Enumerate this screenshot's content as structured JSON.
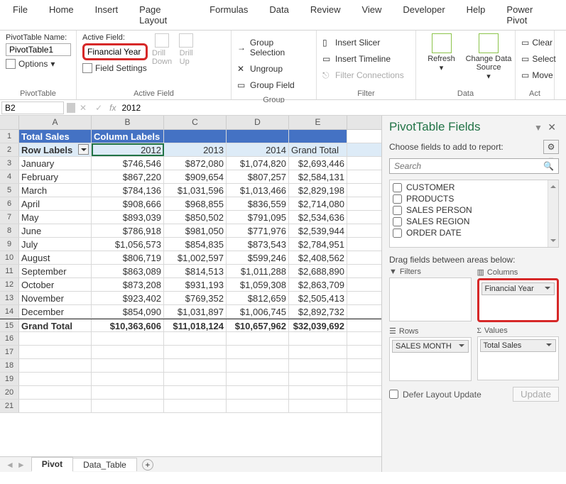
{
  "menu": [
    "File",
    "Home",
    "Insert",
    "Page Layout",
    "Formulas",
    "Data",
    "Review",
    "View",
    "Developer",
    "Help",
    "Power Pivot"
  ],
  "ribbon": {
    "pvt": {
      "nameLabel": "PivotTable Name:",
      "name": "PivotTable1",
      "options": "Options",
      "group": "PivotTable"
    },
    "active": {
      "fieldLabel": "Active Field:",
      "field": "Financial Year",
      "settings": "Field Settings",
      "drillDown": "Drill\nDown",
      "drillUp": "Drill\nUp",
      "group": "Active Field"
    },
    "group": {
      "selection": "Group Selection",
      "ungroup": "Ungroup",
      "field": "Group Field",
      "group": "Group"
    },
    "filter": {
      "slicer": "Insert Slicer",
      "timeline": "Insert Timeline",
      "connections": "Filter Connections",
      "group": "Filter"
    },
    "data": {
      "refresh": "Refresh",
      "change": "Change Data\nSource",
      "group": "Data"
    },
    "actions": {
      "clear": "Clear",
      "select": "Select",
      "move": "Move",
      "group": "Act"
    }
  },
  "formulaBar": {
    "nameBox": "B2",
    "fx": "fx",
    "value": "2012"
  },
  "grid": {
    "cols": [
      "A",
      "B",
      "C",
      "D",
      "E"
    ],
    "row1": {
      "a": "Total Sales",
      "b": "Column Labels"
    },
    "row2": {
      "a": "Row Labels",
      "b": "2012",
      "c": "2013",
      "d": "2014",
      "e": "Grand Total"
    },
    "data": [
      [
        "January",
        "$746,546",
        "$872,080",
        "$1,074,820",
        "$2,693,446"
      ],
      [
        "February",
        "$867,220",
        "$909,654",
        "$807,257",
        "$2,584,131"
      ],
      [
        "March",
        "$784,136",
        "$1,031,596",
        "$1,013,466",
        "$2,829,198"
      ],
      [
        "April",
        "$908,666",
        "$968,855",
        "$836,559",
        "$2,714,080"
      ],
      [
        "May",
        "$893,039",
        "$850,502",
        "$791,095",
        "$2,534,636"
      ],
      [
        "June",
        "$786,918",
        "$981,050",
        "$771,976",
        "$2,539,944"
      ],
      [
        "July",
        "$1,056,573",
        "$854,835",
        "$873,543",
        "$2,784,951"
      ],
      [
        "August",
        "$806,719",
        "$1,002,597",
        "$599,246",
        "$2,408,562"
      ],
      [
        "September",
        "$863,089",
        "$814,513",
        "$1,011,288",
        "$2,688,890"
      ],
      [
        "October",
        "$873,208",
        "$931,193",
        "$1,059,308",
        "$2,863,709"
      ],
      [
        "November",
        "$923,402",
        "$769,352",
        "$812,659",
        "$2,505,413"
      ],
      [
        "December",
        "$854,090",
        "$1,031,897",
        "$1,006,745",
        "$2,892,732"
      ]
    ],
    "total": [
      "Grand Total",
      "$10,363,606",
      "$11,018,124",
      "$10,657,962",
      "$32,039,692"
    ]
  },
  "tabs": {
    "active": "Pivot",
    "other": "Data_Table"
  },
  "fieldsPanel": {
    "title": "PivotTable Fields",
    "choose": "Choose fields to add to report:",
    "searchPlaceholder": "Search",
    "fields": [
      "CUSTOMER",
      "PRODUCTS",
      "SALES PERSON",
      "SALES REGION",
      "ORDER DATE"
    ],
    "dragLabel": "Drag fields between areas below:",
    "areas": {
      "filters": "Filters",
      "columns": "Columns",
      "rows": "Rows",
      "values": "Values",
      "columnsChip": "Financial Year",
      "rowsChip": "SALES MONTH",
      "valuesChip": "Total Sales"
    },
    "defer": "Defer Layout Update",
    "update": "Update"
  }
}
